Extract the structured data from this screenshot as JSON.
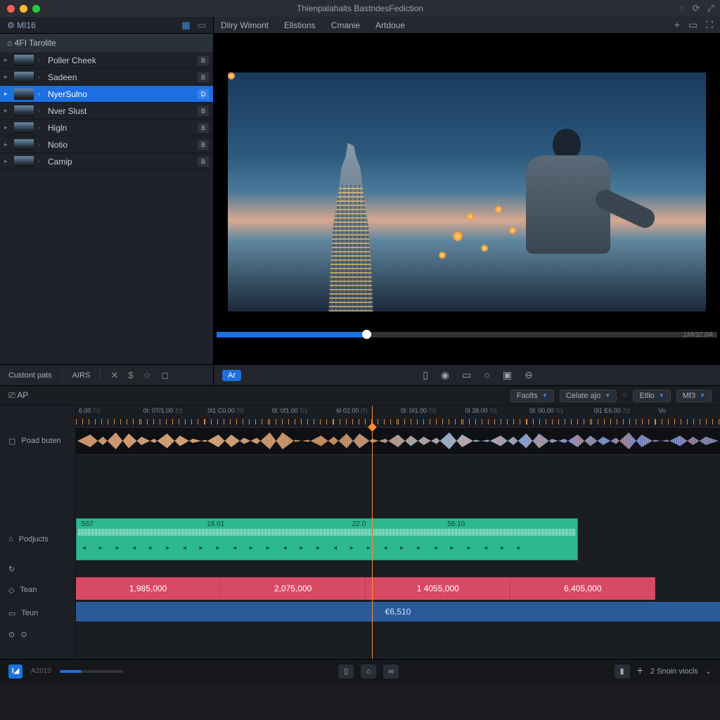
{
  "titlebar": {
    "title": "Thienpalahalts BastndesFediction"
  },
  "left": {
    "tab": "⚙ MI16",
    "header": "⌂ 4FI Tarolite",
    "clips": [
      {
        "name": "Poller Cheek",
        "badge": "B",
        "selected": false
      },
      {
        "name": "Sadeen",
        "badge": "B",
        "selected": false
      },
      {
        "name": "NyerSulno",
        "badge": "D",
        "selected": true
      },
      {
        "name": "Nver Slust",
        "badge": "B",
        "selected": false
      },
      {
        "name": "Higln",
        "badge": "B",
        "selected": false
      },
      {
        "name": "Notio",
        "badge": "B",
        "selected": false
      },
      {
        "name": "Camip",
        "badge": "B",
        "selected": false
      }
    ]
  },
  "topmenu": [
    "Dliry Wimont",
    "Ellstions",
    "Cmanie",
    "Artdoue"
  ],
  "viewer": {
    "ar": "Ar",
    "timecode": "1MI32.0A"
  },
  "left_tools": {
    "a": "Custont pats",
    "b": "AIRS"
  },
  "timeline": {
    "header_label": "⎚ AP",
    "dropdowns": [
      "Faolts",
      "Celate ajo",
      "Etllo",
      "Mf3"
    ],
    "ruler": [
      {
        "maj": "6.00",
        "min": "7/1"
      },
      {
        "maj": "0t: 07/1.00",
        "min": "7/1"
      },
      {
        "maj": "0l1 C0.00",
        "min": "7/1"
      },
      {
        "maj": "0l: 0f1.00",
        "min": "7/1"
      },
      {
        "maj": "6l 02.00",
        "min": "(7)"
      },
      {
        "maj": "0l: 0I1.00",
        "min": "7/1"
      },
      {
        "maj": "0l 38.00",
        "min": "7/1"
      },
      {
        "maj": "0l: 00.00",
        "min": "7/1"
      },
      {
        "maj": "0l1 E6.00",
        "min": "7/1"
      },
      {
        "maj": "Vo",
        "min": ""
      }
    ],
    "tracks": {
      "t1": "Poad buten",
      "t2": "Podjucts",
      "t3": "Tean",
      "t4": "Teun"
    },
    "green_markers": [
      "S67",
      "18.01",
      "22.0",
      "58.10"
    ],
    "red_values": [
      "1,985,000",
      "2,075,000",
      "1 4055,000",
      "6.405,000"
    ],
    "blue_value": "€6,510"
  },
  "footer": {
    "label": "A2010",
    "right": "2 Snoin viocls"
  }
}
